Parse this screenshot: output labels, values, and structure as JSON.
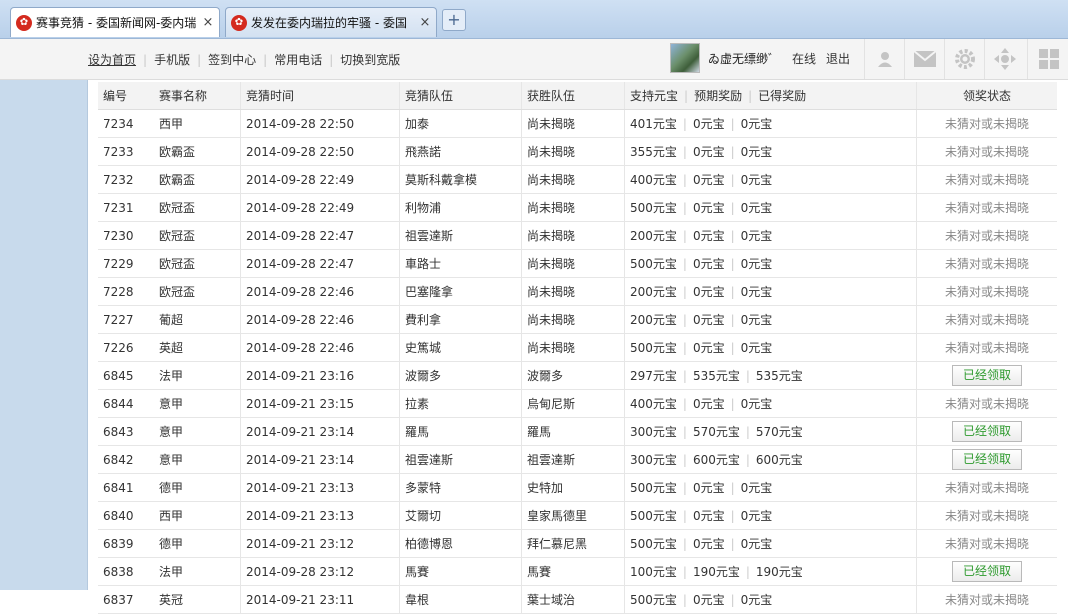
{
  "browser": {
    "tabs": [
      {
        "title": "赛事竞猜 - 委国新闻网-委内瑞",
        "close": "×"
      },
      {
        "title": "发发在委内瑞拉的牢骚 - 委国",
        "close": "×"
      }
    ],
    "new_tab": "+"
  },
  "topbar": {
    "links": [
      "设为首页",
      "手机版",
      "签到中心",
      "常用电话",
      "切换到宽版"
    ],
    "username": "ゐ虚无缥缈゛",
    "status": "在线",
    "logout": "退出",
    "icons": [
      "user-icon",
      "mail-icon",
      "gear-icon",
      "move-icon",
      "grid-icon"
    ]
  },
  "table": {
    "headers": {
      "id": "编号",
      "game": "赛事名称",
      "time": "竞猜时间",
      "team": "竞猜队伍",
      "winner": "获胜队伍",
      "support": "支持元宝",
      "expected": "预期奖励",
      "got": "已得奖励",
      "status": "领奖状态"
    },
    "rows": [
      {
        "id": "7234",
        "game": "西甲",
        "time": "2014-09-28 22:50",
        "team": "加泰",
        "winner": "尚未揭晓",
        "support": "401元宝",
        "expected": "0元宝",
        "got": "0元宝",
        "status": "未猜对或未揭晓",
        "claimed": false
      },
      {
        "id": "7233",
        "game": "欧霸盃",
        "time": "2014-09-28 22:50",
        "team": "飛燕諾",
        "winner": "尚未揭晓",
        "support": "355元宝",
        "expected": "0元宝",
        "got": "0元宝",
        "status": "未猜对或未揭晓",
        "claimed": false
      },
      {
        "id": "7232",
        "game": "欧霸盃",
        "time": "2014-09-28 22:49",
        "team": "莫斯科戴拿模",
        "winner": "尚未揭晓",
        "support": "400元宝",
        "expected": "0元宝",
        "got": "0元宝",
        "status": "未猜对或未揭晓",
        "claimed": false
      },
      {
        "id": "7231",
        "game": "欧冠盃",
        "time": "2014-09-28 22:49",
        "team": "利物浦",
        "winner": "尚未揭晓",
        "support": "500元宝",
        "expected": "0元宝",
        "got": "0元宝",
        "status": "未猜对或未揭晓",
        "claimed": false
      },
      {
        "id": "7230",
        "game": "欧冠盃",
        "time": "2014-09-28 22:47",
        "team": "祖雲達斯",
        "winner": "尚未揭晓",
        "support": "200元宝",
        "expected": "0元宝",
        "got": "0元宝",
        "status": "未猜对或未揭晓",
        "claimed": false
      },
      {
        "id": "7229",
        "game": "欧冠盃",
        "time": "2014-09-28 22:47",
        "team": "車路士",
        "winner": "尚未揭晓",
        "support": "500元宝",
        "expected": "0元宝",
        "got": "0元宝",
        "status": "未猜对或未揭晓",
        "claimed": false
      },
      {
        "id": "7228",
        "game": "欧冠盃",
        "time": "2014-09-28 22:46",
        "team": "巴塞隆拿",
        "winner": "尚未揭晓",
        "support": "200元宝",
        "expected": "0元宝",
        "got": "0元宝",
        "status": "未猜对或未揭晓",
        "claimed": false
      },
      {
        "id": "7227",
        "game": "葡超",
        "time": "2014-09-28 22:46",
        "team": "費利拿",
        "winner": "尚未揭晓",
        "support": "200元宝",
        "expected": "0元宝",
        "got": "0元宝",
        "status": "未猜对或未揭晓",
        "claimed": false
      },
      {
        "id": "7226",
        "game": "英超",
        "time": "2014-09-28 22:46",
        "team": "史篤城",
        "winner": "尚未揭晓",
        "support": "500元宝",
        "expected": "0元宝",
        "got": "0元宝",
        "status": "未猜对或未揭晓",
        "claimed": false
      },
      {
        "id": "6845",
        "game": "法甲",
        "time": "2014-09-21 23:16",
        "team": "波爾多",
        "winner": "波爾多",
        "support": "297元宝",
        "expected": "535元宝",
        "got": "535元宝",
        "status": "已经领取",
        "claimed": true
      },
      {
        "id": "6844",
        "game": "意甲",
        "time": "2014-09-21 23:15",
        "team": "拉素",
        "winner": "烏甸尼斯",
        "support": "400元宝",
        "expected": "0元宝",
        "got": "0元宝",
        "status": "未猜对或未揭晓",
        "claimed": false
      },
      {
        "id": "6843",
        "game": "意甲",
        "time": "2014-09-21 23:14",
        "team": "羅馬",
        "winner": "羅馬",
        "support": "300元宝",
        "expected": "570元宝",
        "got": "570元宝",
        "status": "已经领取",
        "claimed": true
      },
      {
        "id": "6842",
        "game": "意甲",
        "time": "2014-09-21 23:14",
        "team": "祖雲達斯",
        "winner": "祖雲達斯",
        "support": "300元宝",
        "expected": "600元宝",
        "got": "600元宝",
        "status": "已经领取",
        "claimed": true
      },
      {
        "id": "6841",
        "game": "德甲",
        "time": "2014-09-21 23:13",
        "team": "多蒙特",
        "winner": "史特加",
        "support": "500元宝",
        "expected": "0元宝",
        "got": "0元宝",
        "status": "未猜对或未揭晓",
        "claimed": false
      },
      {
        "id": "6840",
        "game": "西甲",
        "time": "2014-09-21 23:13",
        "team": "艾爾切",
        "winner": "皇家馬德里",
        "support": "500元宝",
        "expected": "0元宝",
        "got": "0元宝",
        "status": "未猜对或未揭晓",
        "claimed": false
      },
      {
        "id": "6839",
        "game": "德甲",
        "time": "2014-09-21 23:12",
        "team": "柏德博恩",
        "winner": "拜仁慕尼黑",
        "support": "500元宝",
        "expected": "0元宝",
        "got": "0元宝",
        "status": "未猜对或未揭晓",
        "claimed": false
      },
      {
        "id": "6838",
        "game": "法甲",
        "time": "2014-09-28 23:12",
        "team": "馬賽",
        "winner": "馬賽",
        "support": "100元宝",
        "expected": "190元宝",
        "got": "190元宝",
        "status": "已经领取",
        "claimed": true
      },
      {
        "id": "6837",
        "game": "英冠",
        "time": "2014-09-21 23:11",
        "team": "韋根",
        "winner": "葉士域治",
        "support": "500元宝",
        "expected": "0元宝",
        "got": "0元宝",
        "status": "未猜对或未揭晓",
        "claimed": false
      }
    ]
  }
}
